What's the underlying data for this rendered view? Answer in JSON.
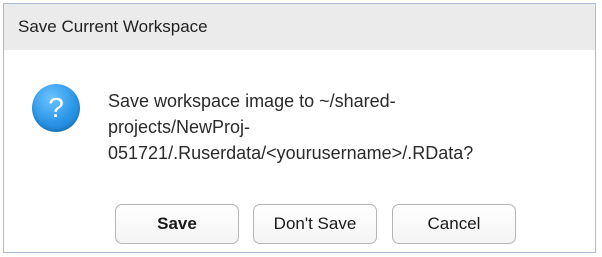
{
  "dialog": {
    "title": "Save Current Workspace",
    "icon": "question-icon",
    "icon_glyph": "?",
    "icon_color": "#2a95e6",
    "message_lines": [
      "Save workspace image to ~/shared-",
      "projects/NewProj-",
      "051721/.Ruserdata/<yourusername>/.RData?"
    ],
    "buttons": {
      "save": "Save",
      "dont_save": "Don't Save",
      "cancel": "Cancel"
    }
  }
}
